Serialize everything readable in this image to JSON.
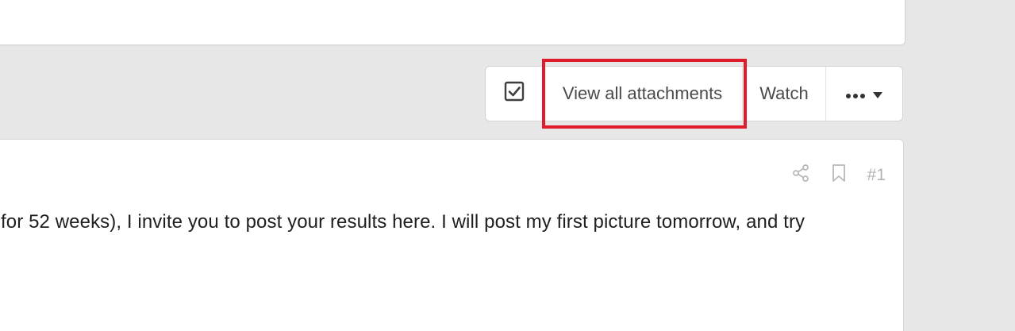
{
  "toolbar": {
    "select_icon": "checkbox-checked-icon",
    "attachments_label": "View all attachments",
    "watch_label": "Watch",
    "more_icon": "ellipsis-icon",
    "more_dropdown_icon": "caret-down-icon"
  },
  "highlight": {
    "color": "#e01b2b"
  },
  "post": {
    "share_icon": "share-icon",
    "bookmark_icon": "bookmark-icon",
    "number": "#1",
    "text": "for 52 weeks), I invite you to post your results here. I will post my first picture tomorrow, and try"
  }
}
